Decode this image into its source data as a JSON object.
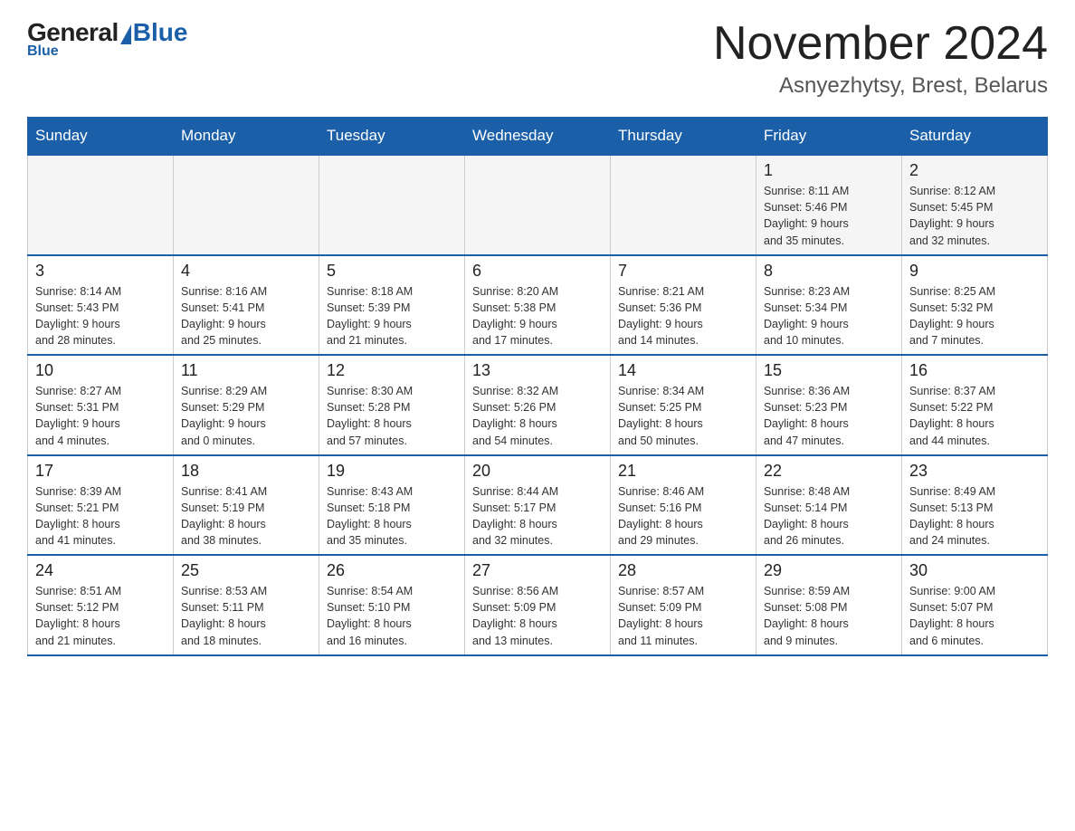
{
  "header": {
    "logo": {
      "general": "General",
      "blue": "Blue"
    },
    "title": "November 2024",
    "subtitle": "Asnyezhytsy, Brest, Belarus"
  },
  "weekdays": [
    "Sunday",
    "Monday",
    "Tuesday",
    "Wednesday",
    "Thursday",
    "Friday",
    "Saturday"
  ],
  "weeks": [
    [
      {
        "day": "",
        "info": ""
      },
      {
        "day": "",
        "info": ""
      },
      {
        "day": "",
        "info": ""
      },
      {
        "day": "",
        "info": ""
      },
      {
        "day": "",
        "info": ""
      },
      {
        "day": "1",
        "info": "Sunrise: 8:11 AM\nSunset: 5:46 PM\nDaylight: 9 hours\nand 35 minutes."
      },
      {
        "day": "2",
        "info": "Sunrise: 8:12 AM\nSunset: 5:45 PM\nDaylight: 9 hours\nand 32 minutes."
      }
    ],
    [
      {
        "day": "3",
        "info": "Sunrise: 8:14 AM\nSunset: 5:43 PM\nDaylight: 9 hours\nand 28 minutes."
      },
      {
        "day": "4",
        "info": "Sunrise: 8:16 AM\nSunset: 5:41 PM\nDaylight: 9 hours\nand 25 minutes."
      },
      {
        "day": "5",
        "info": "Sunrise: 8:18 AM\nSunset: 5:39 PM\nDaylight: 9 hours\nand 21 minutes."
      },
      {
        "day": "6",
        "info": "Sunrise: 8:20 AM\nSunset: 5:38 PM\nDaylight: 9 hours\nand 17 minutes."
      },
      {
        "day": "7",
        "info": "Sunrise: 8:21 AM\nSunset: 5:36 PM\nDaylight: 9 hours\nand 14 minutes."
      },
      {
        "day": "8",
        "info": "Sunrise: 8:23 AM\nSunset: 5:34 PM\nDaylight: 9 hours\nand 10 minutes."
      },
      {
        "day": "9",
        "info": "Sunrise: 8:25 AM\nSunset: 5:32 PM\nDaylight: 9 hours\nand 7 minutes."
      }
    ],
    [
      {
        "day": "10",
        "info": "Sunrise: 8:27 AM\nSunset: 5:31 PM\nDaylight: 9 hours\nand 4 minutes."
      },
      {
        "day": "11",
        "info": "Sunrise: 8:29 AM\nSunset: 5:29 PM\nDaylight: 9 hours\nand 0 minutes."
      },
      {
        "day": "12",
        "info": "Sunrise: 8:30 AM\nSunset: 5:28 PM\nDaylight: 8 hours\nand 57 minutes."
      },
      {
        "day": "13",
        "info": "Sunrise: 8:32 AM\nSunset: 5:26 PM\nDaylight: 8 hours\nand 54 minutes."
      },
      {
        "day": "14",
        "info": "Sunrise: 8:34 AM\nSunset: 5:25 PM\nDaylight: 8 hours\nand 50 minutes."
      },
      {
        "day": "15",
        "info": "Sunrise: 8:36 AM\nSunset: 5:23 PM\nDaylight: 8 hours\nand 47 minutes."
      },
      {
        "day": "16",
        "info": "Sunrise: 8:37 AM\nSunset: 5:22 PM\nDaylight: 8 hours\nand 44 minutes."
      }
    ],
    [
      {
        "day": "17",
        "info": "Sunrise: 8:39 AM\nSunset: 5:21 PM\nDaylight: 8 hours\nand 41 minutes."
      },
      {
        "day": "18",
        "info": "Sunrise: 8:41 AM\nSunset: 5:19 PM\nDaylight: 8 hours\nand 38 minutes."
      },
      {
        "day": "19",
        "info": "Sunrise: 8:43 AM\nSunset: 5:18 PM\nDaylight: 8 hours\nand 35 minutes."
      },
      {
        "day": "20",
        "info": "Sunrise: 8:44 AM\nSunset: 5:17 PM\nDaylight: 8 hours\nand 32 minutes."
      },
      {
        "day": "21",
        "info": "Sunrise: 8:46 AM\nSunset: 5:16 PM\nDaylight: 8 hours\nand 29 minutes."
      },
      {
        "day": "22",
        "info": "Sunrise: 8:48 AM\nSunset: 5:14 PM\nDaylight: 8 hours\nand 26 minutes."
      },
      {
        "day": "23",
        "info": "Sunrise: 8:49 AM\nSunset: 5:13 PM\nDaylight: 8 hours\nand 24 minutes."
      }
    ],
    [
      {
        "day": "24",
        "info": "Sunrise: 8:51 AM\nSunset: 5:12 PM\nDaylight: 8 hours\nand 21 minutes."
      },
      {
        "day": "25",
        "info": "Sunrise: 8:53 AM\nSunset: 5:11 PM\nDaylight: 8 hours\nand 18 minutes."
      },
      {
        "day": "26",
        "info": "Sunrise: 8:54 AM\nSunset: 5:10 PM\nDaylight: 8 hours\nand 16 minutes."
      },
      {
        "day": "27",
        "info": "Sunrise: 8:56 AM\nSunset: 5:09 PM\nDaylight: 8 hours\nand 13 minutes."
      },
      {
        "day": "28",
        "info": "Sunrise: 8:57 AM\nSunset: 5:09 PM\nDaylight: 8 hours\nand 11 minutes."
      },
      {
        "day": "29",
        "info": "Sunrise: 8:59 AM\nSunset: 5:08 PM\nDaylight: 8 hours\nand 9 minutes."
      },
      {
        "day": "30",
        "info": "Sunrise: 9:00 AM\nSunset: 5:07 PM\nDaylight: 8 hours\nand 6 minutes."
      }
    ]
  ],
  "colors": {
    "header_bg": "#1a5fa8",
    "accent": "#1a5fa8"
  }
}
